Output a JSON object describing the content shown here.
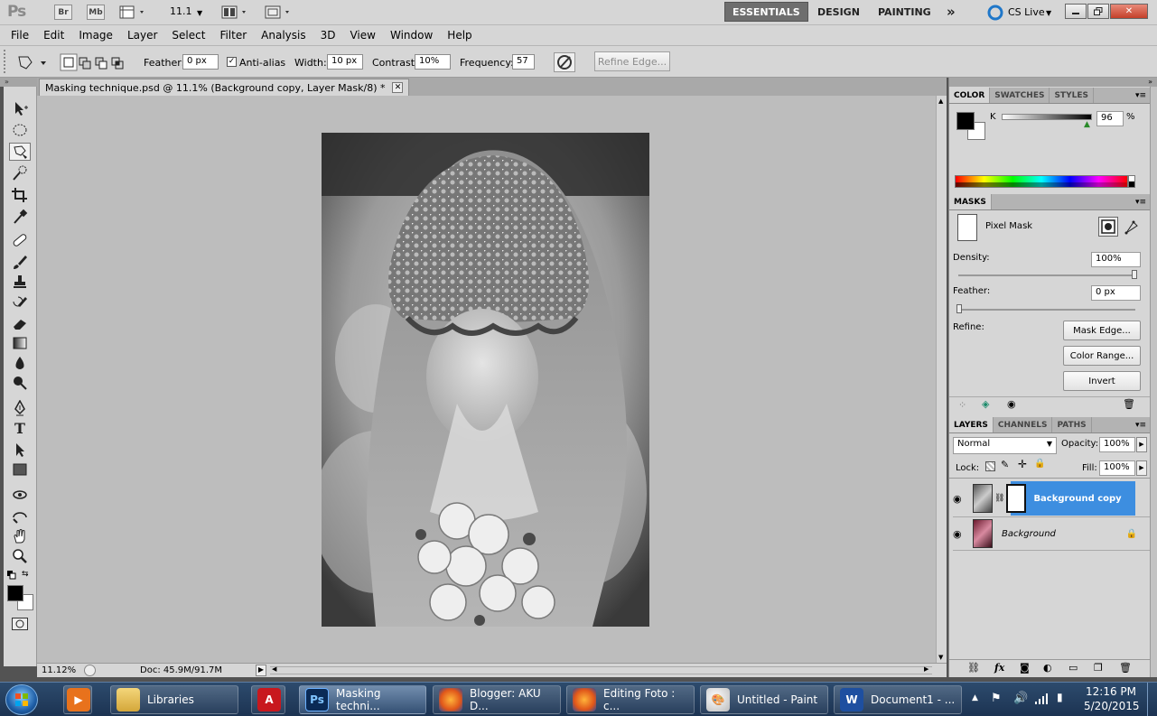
{
  "appbar": {
    "logo": "Ps",
    "bridge": "Br",
    "minibridge": "Mb",
    "zoom": "11.1",
    "workspaces": [
      "ESSENTIALS",
      "DESIGN",
      "PAINTING"
    ],
    "more": "»",
    "cslive": "CS Live"
  },
  "menu": [
    "File",
    "Edit",
    "Image",
    "Layer",
    "Select",
    "Filter",
    "Analysis",
    "3D",
    "View",
    "Window",
    "Help"
  ],
  "options": {
    "feather_label": "Feather:",
    "feather_value": "0 px",
    "antialias_label": "Anti-alias",
    "width_label": "Width:",
    "width_value": "10 px",
    "contrast_label": "Contrast:",
    "contrast_value": "10%",
    "frequency_label": "Frequency:",
    "frequency_value": "57",
    "refine_edge": "Refine Edge..."
  },
  "document": {
    "tab_title": "Masking technique.psd @ 11.1% (Background copy, Layer Mask/8) *",
    "zoom_status": "11.12%",
    "doc_status": "Doc: 45.9M/91.7M"
  },
  "color_panel": {
    "tabs": [
      "COLOR",
      "SWATCHES",
      "STYLES"
    ],
    "channel": "K",
    "value": "96",
    "unit": "%",
    "slider_level": 0.96
  },
  "masks_panel": {
    "title": "MASKS",
    "pixel_mask": "Pixel Mask",
    "density_label": "Density:",
    "density_value": "100%",
    "feather_label": "Feather:",
    "feather_value": "0 px",
    "refine_label": "Refine:",
    "mask_edge": "Mask Edge...",
    "color_range": "Color Range...",
    "invert": "Invert"
  },
  "layers_panel": {
    "tabs": [
      "LAYERS",
      "CHANNELS",
      "PATHS"
    ],
    "blend_mode": "Normal",
    "opacity_label": "Opacity:",
    "opacity_value": "100%",
    "lock_label": "Lock:",
    "fill_label": "Fill:",
    "fill_value": "100%",
    "layers": [
      {
        "name": "Background copy",
        "selected": true
      },
      {
        "name": "Background",
        "selected": false
      }
    ]
  },
  "taskbar": {
    "items": [
      {
        "label": "Libraries"
      },
      {
        "label": "Masking techni..."
      },
      {
        "label": "Blogger: AKU D..."
      },
      {
        "label": "Editing Foto : c..."
      },
      {
        "label": "Untitled - Paint"
      },
      {
        "label": "Document1 - ..."
      }
    ],
    "time": "12:16 PM",
    "date": "5/20/2015"
  },
  "colors": {
    "selected_layer": "#3d8ee0",
    "canvas_bg": "#bdbdbd",
    "ui_gray": "#d6d6d6"
  }
}
